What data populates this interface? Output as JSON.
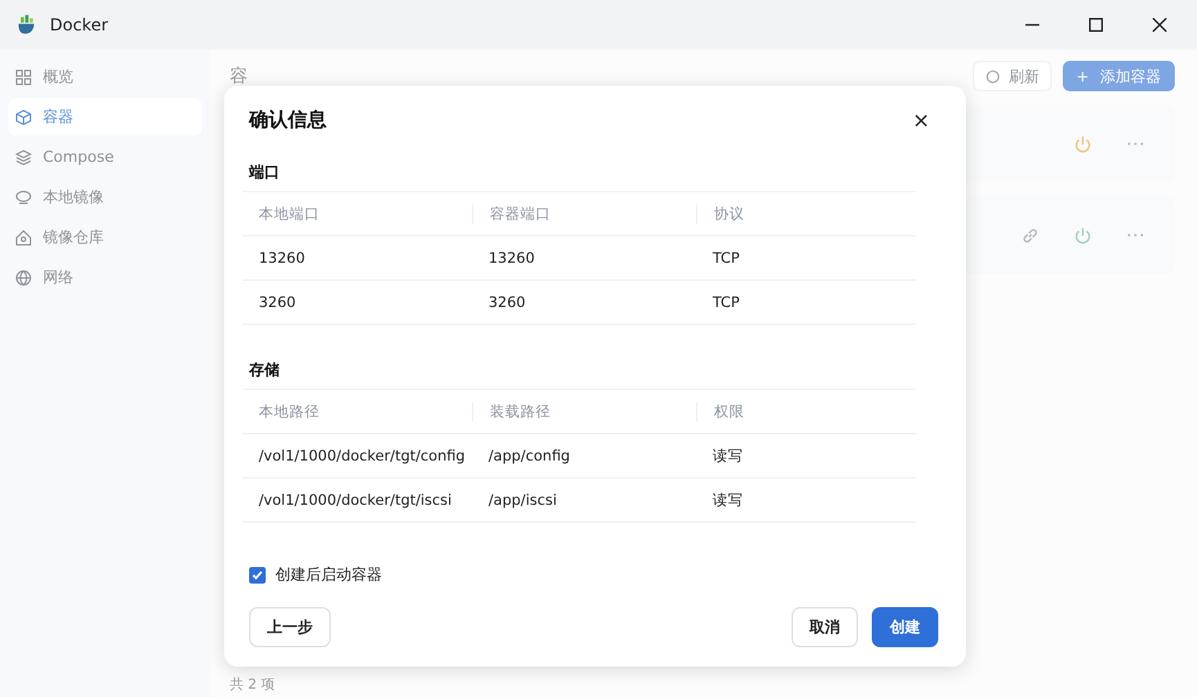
{
  "window": {
    "title": "Docker"
  },
  "sidebar": {
    "items": [
      {
        "label": "概览",
        "selected": false
      },
      {
        "label": "容器",
        "selected": true
      },
      {
        "label": "Compose",
        "selected": false
      },
      {
        "label": "本地镜像",
        "selected": false
      },
      {
        "label": "镜像仓库",
        "selected": false
      },
      {
        "label": "网络",
        "selected": false
      }
    ]
  },
  "main": {
    "title": "容",
    "refresh": "刷新",
    "add": "添加容器",
    "add_icon": "+",
    "rows": [
      {
        "color": "#f2c27e",
        "link": false
      },
      {
        "color": "#9fd3bb",
        "link": true
      }
    ],
    "footer": "共 2 项"
  },
  "dialog": {
    "title": "确认信息",
    "close": "×",
    "sections": [
      {
        "title": "端口",
        "columns": [
          "本地端口",
          "容器端口",
          "协议"
        ],
        "rows": [
          [
            "13260",
            "13260",
            "TCP"
          ],
          [
            "3260",
            "3260",
            "TCP"
          ]
        ]
      },
      {
        "title": "存储",
        "columns": [
          "本地路径",
          "装载路径",
          "权限"
        ],
        "rows": [
          [
            "/vol1/1000/docker/tgt/config",
            "/app/config",
            "读写"
          ],
          [
            "/vol1/1000/docker/tgt/iscsi",
            "/app/iscsi",
            "读写"
          ]
        ]
      }
    ],
    "start_after": {
      "label": "创建后启动容器",
      "checked": true
    },
    "buttons": [
      {
        "label": "上一步",
        "kind": "default"
      },
      {
        "label": "取消",
        "kind": "spacer-default"
      },
      {
        "label": "创建",
        "kind": "primary"
      }
    ]
  }
}
